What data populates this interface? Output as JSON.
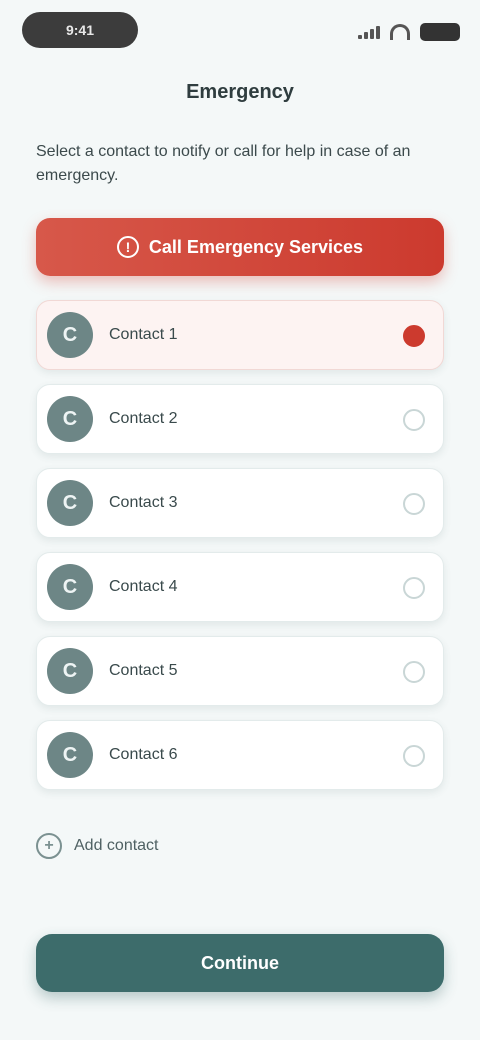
{
  "status_bar": {
    "time": "9:41",
    "icons": [
      "cellular-signal-icon",
      "wifi-icon",
      "battery-icon"
    ]
  },
  "header": {
    "title": "Emergency"
  },
  "instruction": "Select a contact to notify or call for help in case of an emergency.",
  "alert_banner": {
    "label": "Call Emergency Services",
    "icon": "alert-icon",
    "color": "#cc3a2e"
  },
  "options": [
    {
      "label": "Contact 1",
      "initial": "C",
      "selected": true
    },
    {
      "label": "Contact 2",
      "initial": "C",
      "selected": false
    },
    {
      "label": "Contact 3",
      "initial": "C",
      "selected": false
    },
    {
      "label": "Contact 4",
      "initial": "C",
      "selected": false
    },
    {
      "label": "Contact 5",
      "initial": "C",
      "selected": false
    },
    {
      "label": "Contact 6",
      "initial": "C",
      "selected": false
    }
  ],
  "secondary_link": {
    "label": "Add contact",
    "icon": "plus-icon"
  },
  "primary_button": {
    "label": "Continue",
    "color": "#3d6c6b"
  }
}
